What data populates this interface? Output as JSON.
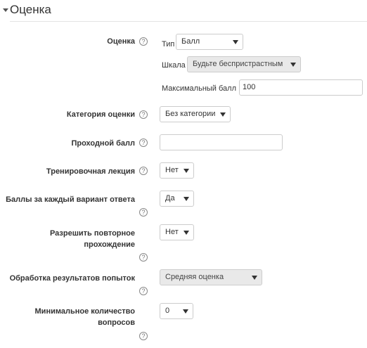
{
  "section": {
    "title": "Оценка"
  },
  "grade": {
    "label": "Оценка",
    "type_label": "Тип",
    "type_value": "Балл",
    "scale_label": "Шкала",
    "scale_value": "Будьте беспристрастным",
    "maxgrade_label": "Максимальный балл",
    "maxgrade_value": "100"
  },
  "category": {
    "label": "Категория оценки",
    "value": "Без категории"
  },
  "passing": {
    "label": "Проходной балл",
    "value": ""
  },
  "practice": {
    "label": "Тренировочная лекция",
    "value": "Нет"
  },
  "custom_scoring": {
    "label": "Баллы за каждый вариант ответа",
    "value": "Да"
  },
  "retake": {
    "label_line1": "Разрешить повторное",
    "label_line2": "прохождение",
    "value": "Нет"
  },
  "handling": {
    "label": "Обработка результатов попыток",
    "value": "Средняя оценка"
  },
  "minquestions": {
    "label_line1": "Минимальное количество",
    "label_line2": "вопросов",
    "value": "0"
  },
  "icons": {
    "help": "question-circle-icon",
    "collapse": "caret-down-icon"
  }
}
